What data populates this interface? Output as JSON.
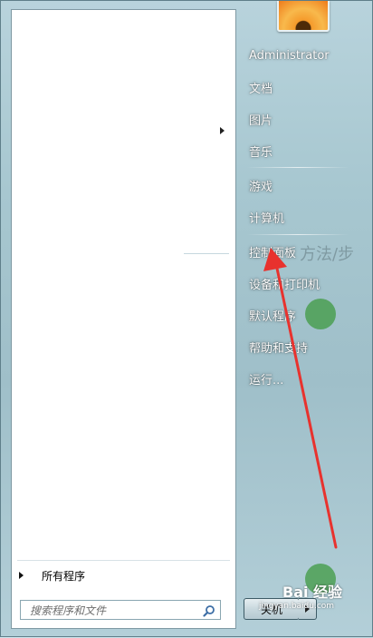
{
  "user": {
    "name": "Administrator"
  },
  "right_items": [
    {
      "label": "Administrator"
    },
    {
      "label": "文档"
    },
    {
      "label": "图片"
    },
    {
      "label": "音乐"
    },
    {
      "label": "游戏"
    },
    {
      "label": "计算机"
    },
    {
      "label": "控制面板"
    },
    {
      "label": "设备和打印机"
    },
    {
      "label": "默认程序"
    },
    {
      "label": "帮助和支持"
    },
    {
      "label": "运行..."
    }
  ],
  "left": {
    "all_programs": "所有程序",
    "search_placeholder": "搜索程序和文件"
  },
  "shutdown": {
    "label": "关机"
  },
  "background": {
    "text": "方法/步"
  },
  "watermark": {
    "brand": "Bai 经验",
    "url": "jingyan.baidu.com"
  },
  "colors": {
    "annotation": "#e8322e",
    "menu_text": "#ffffff"
  }
}
